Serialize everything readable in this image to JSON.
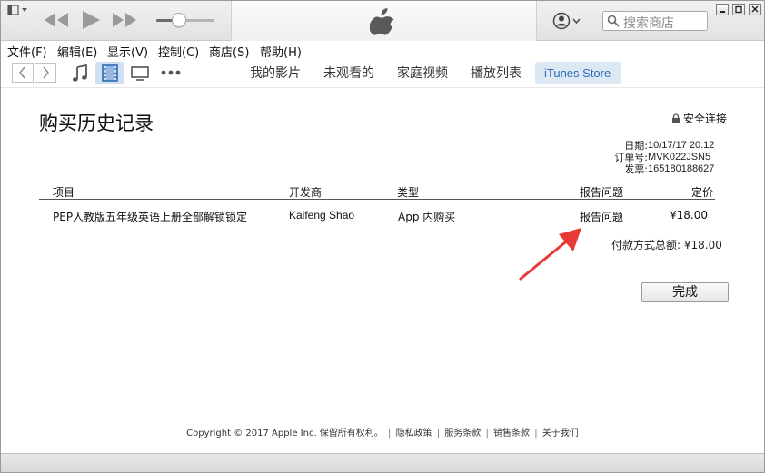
{
  "toolbar": {
    "search_placeholder": "搜索商店",
    "volume_level": 0.4
  },
  "menu": {
    "items": [
      "文件(F)",
      "编辑(E)",
      "显示(V)",
      "控制(C)",
      "商店(S)",
      "帮助(H)"
    ]
  },
  "nav": {
    "tabs": [
      "我的影片",
      "未观看的",
      "家庭视频",
      "播放列表"
    ],
    "active_tab": "iTunes Store"
  },
  "receipt": {
    "title": "购买历史记录",
    "secure_label": "安全连接",
    "meta": [
      {
        "key": "日期:",
        "value": "10/17/17 20:12"
      },
      {
        "key": "订单号:",
        "value": "MVK022JSN5"
      },
      {
        "key": "发票:",
        "value": "165180188627"
      }
    ],
    "columns": {
      "item": "项目",
      "developer": "开发商",
      "type": "类型",
      "report": "报告问题",
      "price": "定价"
    },
    "row": {
      "item": "PEP人教版五年级英语上册全部解锁锁定",
      "developer": "Kaifeng Shao",
      "type": "App 内购买",
      "report": "报告问题",
      "price": "¥18.00"
    },
    "total": "付款方式总额: ¥18.00",
    "done_label": "完成"
  },
  "footer": {
    "copyright": "Copyright © 2017 Apple Inc. 保留所有权利。",
    "links": [
      "隐私政策",
      "服务条款",
      "销售条款",
      "关于我们"
    ]
  },
  "colors": {
    "accent": "#2d6bb5",
    "annotation_arrow": "#e83a35"
  }
}
